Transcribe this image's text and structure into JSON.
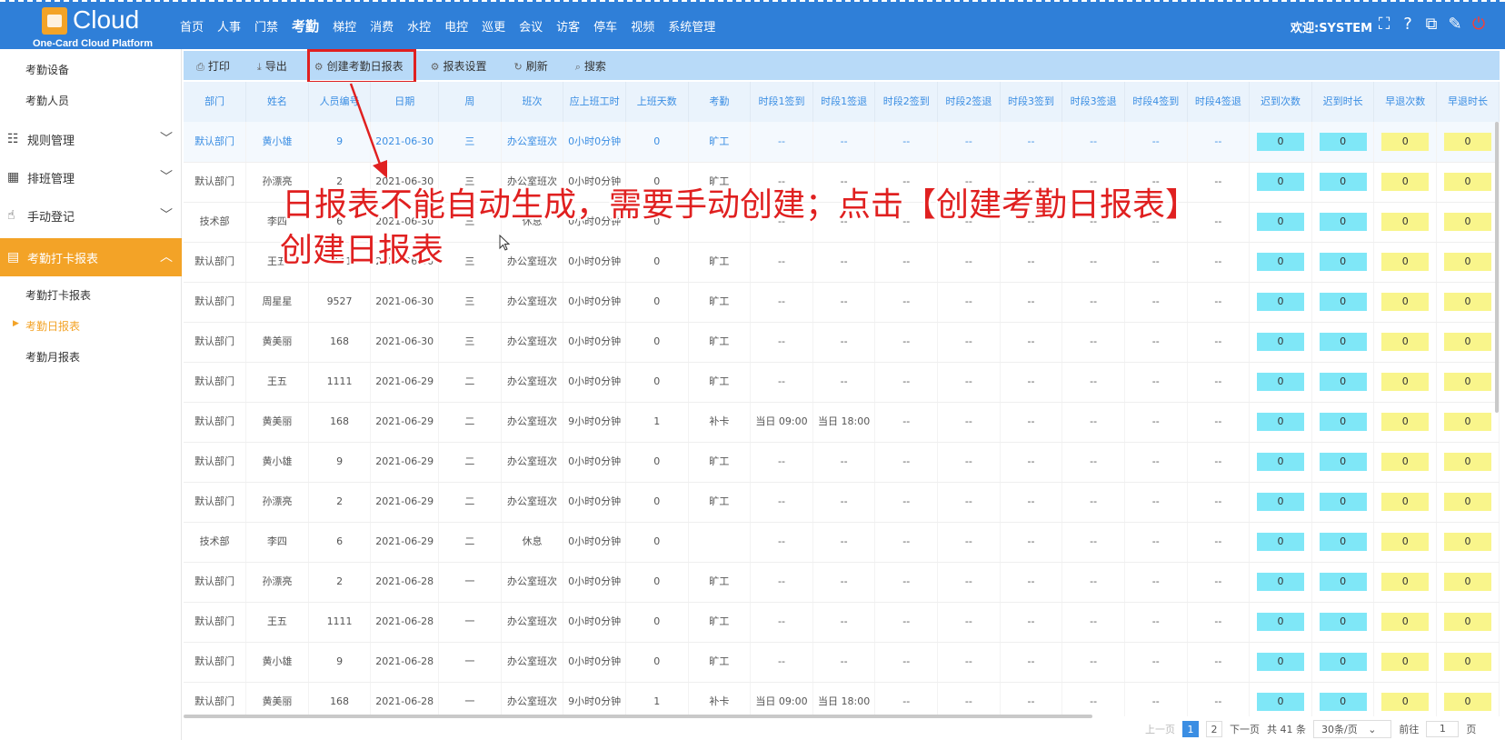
{
  "header": {
    "logo_text": "Cloud",
    "logo_sub": "One-Card Cloud Platform",
    "nav": [
      "首页",
      "人事",
      "门禁",
      "考勤",
      "梯控",
      "消费",
      "水控",
      "电控",
      "巡更",
      "会议",
      "访客",
      "停车",
      "视频",
      "系统管理"
    ],
    "active_nav": "考勤",
    "welcome": "欢迎:SYSTEM",
    "icons": [
      "fullscreen-icon",
      "help-icon",
      "translate-icon",
      "edit-icon",
      "power-icon"
    ]
  },
  "sidebar": {
    "top_items": [
      "考勤设备",
      "考勤人员"
    ],
    "groups": [
      {
        "label": "规则管理",
        "icon": "list-icon"
      },
      {
        "label": "排班管理",
        "icon": "calendar-icon"
      },
      {
        "label": "手动登记",
        "icon": "hand-icon"
      },
      {
        "label": "考勤打卡报表",
        "icon": "chart-icon"
      }
    ],
    "sub_items": [
      "考勤打卡报表",
      "考勤日报表",
      "考勤月报表"
    ],
    "current": "考勤日报表"
  },
  "toolbar": {
    "print": "打印",
    "export": "导出",
    "create": "创建考勤日报表",
    "settings": "报表设置",
    "refresh": "刷新",
    "search": "搜索"
  },
  "table": {
    "headers": [
      "部门",
      "姓名",
      "人员编号",
      "日期",
      "周",
      "班次",
      "应上班工时",
      "上班天数",
      "考勤",
      "时段1签到",
      "时段1签退",
      "时段2签到",
      "时段2签退",
      "时段3签到",
      "时段3签退",
      "时段4签到",
      "时段4签退",
      "迟到次数",
      "迟到时长",
      "早退次数",
      "早退时长"
    ],
    "rows": [
      [
        "默认部门",
        "黄小雄",
        "9",
        "2021-06-30",
        "三",
        "办公室班次",
        "0小时0分钟",
        "0",
        "旷工",
        "--",
        "--",
        "--",
        "--",
        "--",
        "--",
        "--",
        "--",
        "0",
        "0",
        "0",
        "0"
      ],
      [
        "默认部门",
        "孙漂亮",
        "2",
        "2021-06-30",
        "三",
        "办公室班次",
        "0小时0分钟",
        "0",
        "旷工",
        "--",
        "--",
        "--",
        "--",
        "--",
        "--",
        "--",
        "--",
        "0",
        "0",
        "0",
        "0"
      ],
      [
        "技术部",
        "李四",
        "6",
        "2021-06-30",
        "三",
        "休息",
        "0小时0分钟",
        "0",
        "",
        "--",
        "--",
        "--",
        "--",
        "--",
        "--",
        "--",
        "--",
        "0",
        "0",
        "0",
        "0"
      ],
      [
        "默认部门",
        "王五",
        "1111",
        "2021-06-30",
        "三",
        "办公室班次",
        "0小时0分钟",
        "0",
        "旷工",
        "--",
        "--",
        "--",
        "--",
        "--",
        "--",
        "--",
        "--",
        "0",
        "0",
        "0",
        "0"
      ],
      [
        "默认部门",
        "周星星",
        "9527",
        "2021-06-30",
        "三",
        "办公室班次",
        "0小时0分钟",
        "0",
        "旷工",
        "--",
        "--",
        "--",
        "--",
        "--",
        "--",
        "--",
        "--",
        "0",
        "0",
        "0",
        "0"
      ],
      [
        "默认部门",
        "黄美丽",
        "168",
        "2021-06-30",
        "三",
        "办公室班次",
        "0小时0分钟",
        "0",
        "旷工",
        "--",
        "--",
        "--",
        "--",
        "--",
        "--",
        "--",
        "--",
        "0",
        "0",
        "0",
        "0"
      ],
      [
        "默认部门",
        "王五",
        "1111",
        "2021-06-29",
        "二",
        "办公室班次",
        "0小时0分钟",
        "0",
        "旷工",
        "--",
        "--",
        "--",
        "--",
        "--",
        "--",
        "--",
        "--",
        "0",
        "0",
        "0",
        "0"
      ],
      [
        "默认部门",
        "黄美丽",
        "168",
        "2021-06-29",
        "二",
        "办公室班次",
        "9小时0分钟",
        "1",
        "补卡",
        "当日 09:00",
        "当日 18:00",
        "--",
        "--",
        "--",
        "--",
        "--",
        "--",
        "0",
        "0",
        "0",
        "0"
      ],
      [
        "默认部门",
        "黄小雄",
        "9",
        "2021-06-29",
        "二",
        "办公室班次",
        "0小时0分钟",
        "0",
        "旷工",
        "--",
        "--",
        "--",
        "--",
        "--",
        "--",
        "--",
        "--",
        "0",
        "0",
        "0",
        "0"
      ],
      [
        "默认部门",
        "孙漂亮",
        "2",
        "2021-06-29",
        "二",
        "办公室班次",
        "0小时0分钟",
        "0",
        "旷工",
        "--",
        "--",
        "--",
        "--",
        "--",
        "--",
        "--",
        "--",
        "0",
        "0",
        "0",
        "0"
      ],
      [
        "技术部",
        "李四",
        "6",
        "2021-06-29",
        "二",
        "休息",
        "0小时0分钟",
        "0",
        "",
        "--",
        "--",
        "--",
        "--",
        "--",
        "--",
        "--",
        "--",
        "0",
        "0",
        "0",
        "0"
      ],
      [
        "默认部门",
        "孙漂亮",
        "2",
        "2021-06-28",
        "一",
        "办公室班次",
        "0小时0分钟",
        "0",
        "旷工",
        "--",
        "--",
        "--",
        "--",
        "--",
        "--",
        "--",
        "--",
        "0",
        "0",
        "0",
        "0"
      ],
      [
        "默认部门",
        "王五",
        "1111",
        "2021-06-28",
        "一",
        "办公室班次",
        "0小时0分钟",
        "0",
        "旷工",
        "--",
        "--",
        "--",
        "--",
        "--",
        "--",
        "--",
        "--",
        "0",
        "0",
        "0",
        "0"
      ],
      [
        "默认部门",
        "黄小雄",
        "9",
        "2021-06-28",
        "一",
        "办公室班次",
        "0小时0分钟",
        "0",
        "旷工",
        "--",
        "--",
        "--",
        "--",
        "--",
        "--",
        "--",
        "--",
        "0",
        "0",
        "0",
        "0"
      ],
      [
        "默认部门",
        "黄美丽",
        "168",
        "2021-06-28",
        "一",
        "办公室班次",
        "9小时0分钟",
        "1",
        "补卡",
        "当日 09:00",
        "当日 18:00",
        "--",
        "--",
        "--",
        "--",
        "--",
        "--",
        "0",
        "0",
        "0",
        "0"
      ]
    ]
  },
  "pager": {
    "prev": "上一页",
    "pages": [
      "1",
      "2"
    ],
    "current": "1",
    "next": "下一页",
    "total": "共 41 条",
    "page_size": "30条/页",
    "goto_label": "前往",
    "goto_value": "1",
    "page_unit": "页"
  },
  "annotation": {
    "line1": "日报表不能自动生成，需要手动创建；点击【创建考勤日报表】",
    "line2": "创建日报表",
    "color": "#e02020"
  }
}
